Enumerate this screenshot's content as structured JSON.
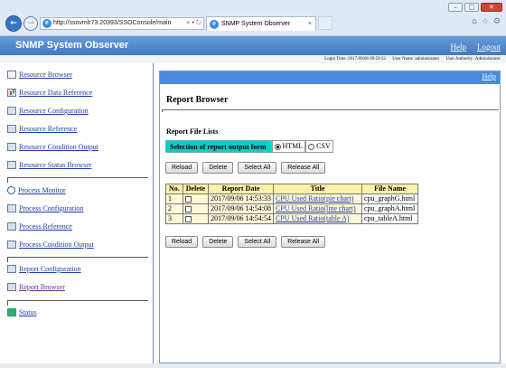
{
  "browser": {
    "url": "http://ssovmlr73:20393/SSOConsole/main",
    "url_tools": "⌕ ▾ ↻",
    "tab_title": "SNMP System Observer",
    "window_controls": [
      "–",
      "□",
      "✕"
    ],
    "toolbar_icons": [
      "⌂",
      "☆",
      "⚙"
    ]
  },
  "app": {
    "title": "SNMP System Observer",
    "help": "Help",
    "logout": "Logout",
    "login_time": "Login Time :2017/09/06 09:50:32",
    "user_name": "User Name :administrator",
    "user_authority": "User Authority :Administrator"
  },
  "sidebar": {
    "group1": [
      {
        "label": "Resource Browser",
        "icon": "browser-icon"
      },
      {
        "label": "Resource Data Reference",
        "icon": "data-icon"
      },
      {
        "label": "Resource Configuration",
        "icon": "config-icon"
      },
      {
        "label": "Resource Reference",
        "icon": "reference-icon"
      },
      {
        "label": "Resource Condition Output",
        "icon": "condition-icon"
      },
      {
        "label": "Resource Status Browser",
        "icon": "status-icon"
      }
    ],
    "group2": [
      {
        "label": "Process Monitor",
        "icon": "monitor-icon"
      },
      {
        "label": "Process Configuration",
        "icon": "config-icon"
      },
      {
        "label": "Process Reference",
        "icon": "reference-icon"
      },
      {
        "label": "Process Condition Output",
        "icon": "condition-icon"
      }
    ],
    "group3": [
      {
        "label": "Report Configuration",
        "icon": "report-config-icon"
      },
      {
        "label": "Report Browser",
        "icon": "report-browser-icon"
      }
    ],
    "group4": [
      {
        "label": "Status",
        "icon": "status-chart-icon"
      }
    ]
  },
  "main": {
    "help_link": "Help",
    "page_title": "Report Browser",
    "section_title": "Report File Lists",
    "output_form_label": "Selection of report output form",
    "output_options": [
      "HTML",
      "CSV"
    ],
    "output_selected": "HTML",
    "buttons": {
      "reload": "Reload",
      "delete": "Delete",
      "select_all": "Select All",
      "release_all": "Release All"
    },
    "table": {
      "headers": [
        "No.",
        "Delete",
        "Report Date",
        "Title",
        "File Name"
      ],
      "rows": [
        {
          "no": "1",
          "date": "2017/09/06 14:53:33",
          "title": "CPU Used Ratio(pie chart)",
          "file": "cpu_graphG.html"
        },
        {
          "no": "2",
          "date": "2017/09/06 14:54:08",
          "title": "CPU Used Ratio(line chart)",
          "file": "cpu_graphA.html"
        },
        {
          "no": "3",
          "date": "2017/09/06 14:54:54",
          "title": "CPU Used Ratio(table A)",
          "file": "cpu_tableA.html"
        }
      ]
    }
  }
}
